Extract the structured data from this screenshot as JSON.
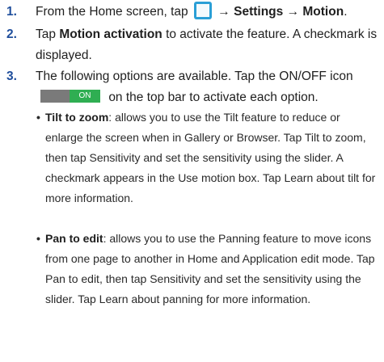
{
  "steps": [
    {
      "num": "1.",
      "pre": "From the Home screen, tap",
      "arrow1": "→",
      "settings": "Settings",
      "arrow2": "→",
      "motion": "Motion",
      "end": "."
    },
    {
      "num": "2.",
      "pre": "Tap",
      "bold": "Motion activation",
      "post": "to activate the feature. A checkmark is displayed."
    },
    {
      "num": "3.",
      "line1": "The following options are available. Tap the ON/OFF",
      "icon_word": "icon",
      "toggle_label": "ON",
      "post": "on the top bar to activate each option."
    }
  ],
  "bullets": [
    {
      "dot": "•",
      "title": "Tilt to zoom",
      "desc": ": allows you to use the Tilt feature to reduce or enlarge the screen when in Gallery or Browser. Tap Tilt to zoom, then tap Sensitivity and set the sensitivity using the slider. A checkmark appears in the Use motion box. Tap Learn about tilt for more information."
    },
    {
      "dot": "•",
      "title": "Pan to edit",
      "desc": ": allows you to use the Panning feature to move icons from one page to another in Home and Application edit mode. Tap Pan to edit, then tap Sensitivity and set the sensitivity using the slider. Tap Learn about panning for more information."
    }
  ],
  "icons": {
    "apps": "apps-grid-icon",
    "toggle": "on-off-toggle-icon"
  },
  "colors": {
    "step_number": "#1f4e9c",
    "apps_icon": "#2a9fd6",
    "toggle_on": "#2fae52",
    "toggle_off": "#7a7a7a"
  }
}
